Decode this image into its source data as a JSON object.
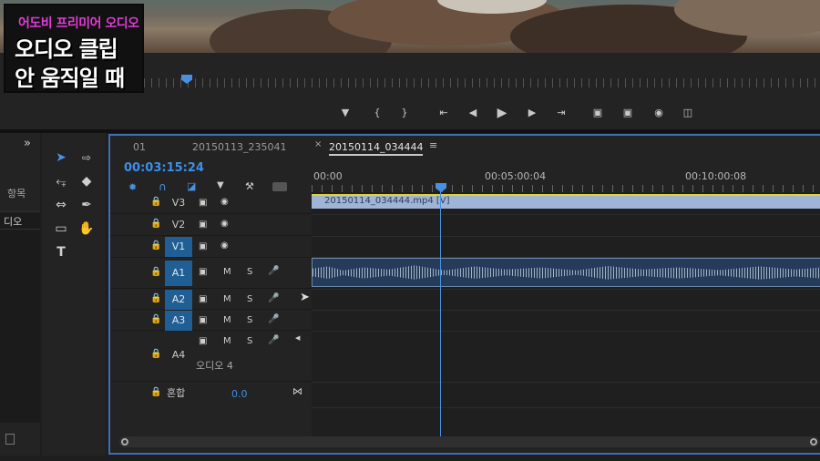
{
  "overlay": {
    "subtitle": "어도비 프리미어 오디오",
    "line1": "오디오 클립",
    "line2": "안 움직일 때"
  },
  "project_panel": {
    "expand_icon": "»",
    "items_label": "항목",
    "row_text": "디오"
  },
  "monitor_controls": [
    "marker-icon",
    "mark-in-icon",
    "mark-out-icon",
    "go-to-in-icon",
    "step-back-icon",
    "play-icon",
    "step-forward-icon",
    "go-to-out-icon",
    "insert-icon",
    "overwrite-icon",
    "export-frame-icon",
    "compare-icon"
  ],
  "timeline": {
    "tab_01": "01",
    "tab_other": "20150113_235041",
    "tab_active": "20150114_034444",
    "timecode": "00:03:15:24",
    "ruler": [
      "00:00",
      "00:05:00:04",
      "00:10:00:08"
    ],
    "video_clip_name": "20150114_034444.mp4 [V]",
    "tracks": {
      "v3": "V3",
      "v2": "V2",
      "v1": "V1",
      "a1": "A1",
      "a2": "A2",
      "a3": "A3",
      "a4": "A4",
      "a4_name": "오디오 4",
      "mix_label": "혼합",
      "mix_value": "0.0",
      "mute": "M",
      "solo": "S"
    }
  }
}
